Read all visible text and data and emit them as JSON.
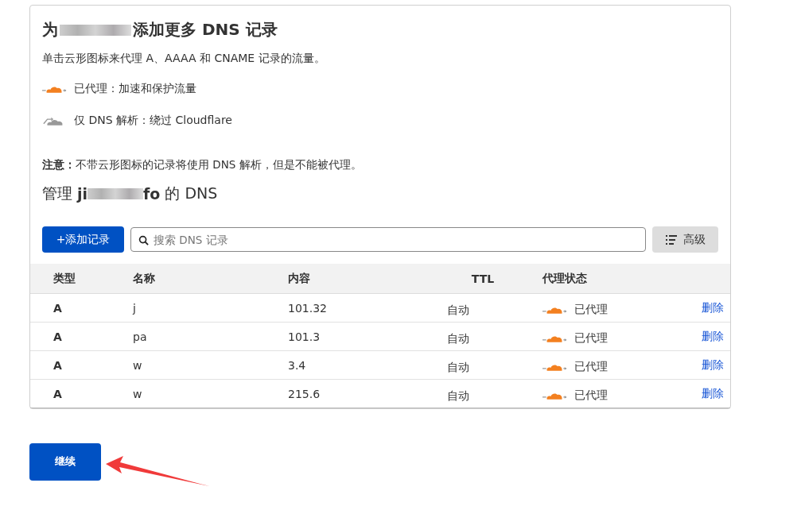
{
  "title": {
    "before": "为",
    "after": "添加更多 DNS 记录"
  },
  "intro": "单击云形图标来代理 A、AAAA 和 CNAME 记录的流量。",
  "legend": [
    {
      "proxied": true,
      "label": "已代理：加速和保护流量"
    },
    {
      "proxied": false,
      "label": "仅 DNS 解析：绕过 Cloudflare"
    }
  ],
  "note": "**注意：**不带云形图标的记录将使用 DNS 解析，但是不能被代理。",
  "manage": {
    "before": "管理",
    "domain_start": "ji",
    "domain_end": "fo",
    "after": "的 DNS"
  },
  "toolbar": {
    "add_button": "+添加记录",
    "search": {
      "placeholder": "搜索 DNS 记录"
    },
    "advanced_button": "高级"
  },
  "table": {
    "columns": [
      "类型",
      "名称",
      "内容",
      "TTL",
      "代理状态"
    ],
    "rows": [
      {
        "type": "A",
        "name": "j",
        "content": "101.32",
        "ttl": "自动",
        "proxied": true,
        "status": "已代理",
        "action": "删除"
      },
      {
        "type": "A",
        "name": "pa",
        "content": "101.3",
        "ttl": "自动",
        "proxied": true,
        "status": "已代理",
        "action": "删除"
      },
      {
        "type": "A",
        "name": "w",
        "content": "3.4",
        "ttl": "自动",
        "proxied": true,
        "status": "已代理",
        "action": "删除"
      },
      {
        "type": "A",
        "name": "w",
        "content": "215.6",
        "ttl": "自动",
        "proxied": true,
        "status": "已代理",
        "action": "删除"
      }
    ]
  },
  "continue_button": "继续"
}
